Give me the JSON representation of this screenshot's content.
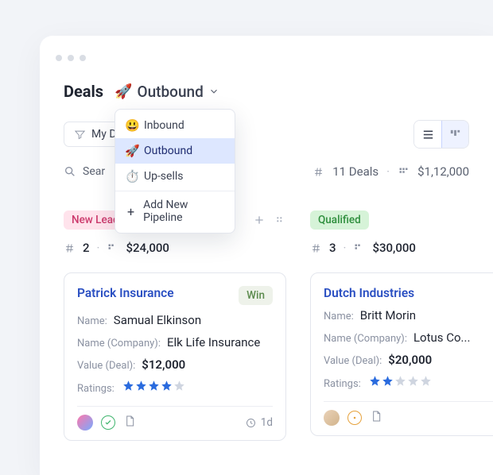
{
  "header": {
    "title": "Deals",
    "pipeline_emoji": "🚀",
    "pipeline_name": "Outbound"
  },
  "pipeline_menu": {
    "items": [
      {
        "emoji": "😃",
        "label": "Inbound"
      },
      {
        "emoji": "🚀",
        "label": "Outbound"
      },
      {
        "emoji": "⏱️",
        "label": "Up-sells"
      }
    ],
    "add_label": "Add New Pipeline"
  },
  "filters": {
    "my_deals_label": "My D"
  },
  "search": {
    "placeholder": "Sear"
  },
  "summary": {
    "deal_count": "11 Deals",
    "total_value": "$1,12,000"
  },
  "columns": [
    {
      "stage": "New Lead",
      "count": "2",
      "value": "$24,000",
      "card": {
        "title": "Patrick Insurance",
        "badge": "Win",
        "name_label": "Name:",
        "name_value": "Samual Elkinson",
        "company_label": "Name (Company):",
        "company_value": "Elk Life Insurance",
        "deal_value_label": "Value (Deal):",
        "deal_value": "$12,000",
        "ratings_label": "Ratings:",
        "stars_filled": 4,
        "age": "1d"
      }
    },
    {
      "stage": "Qualified",
      "count": "3",
      "value": "$30,000",
      "card": {
        "title": "Dutch Industries",
        "name_label": "Name:",
        "name_value": "Britt Morin",
        "company_label": "Name (Company):",
        "company_value": "Lotus Co...",
        "deal_value_label": "Value (Deal):",
        "deal_value": "$20,000",
        "ratings_label": "Ratings:",
        "stars_filled": 2
      }
    }
  ]
}
